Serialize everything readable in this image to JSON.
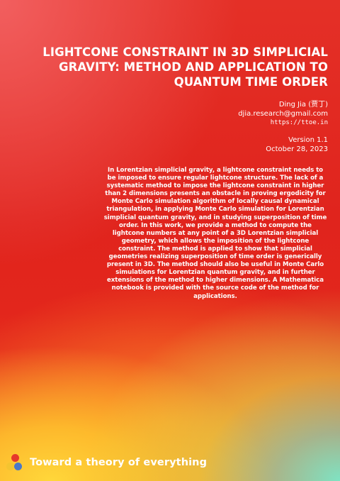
{
  "paper": {
    "title": "LIGHTCONE CONSTRAINT IN 3D SIMPLICIAL GRAVITY: METHOD AND APPLICATION TO QUANTUM TIME ORDER",
    "author": "Ding Jia (贾丁)",
    "email": "djia.research@gmail.com",
    "website": "https://ttoe.in",
    "version": "Version 1.1",
    "date": "October 28, 2023",
    "abstract": "In Lorentzian simplicial gravity, a lightcone constraint needs to be imposed to ensure regular lightcone structure. The lack of a systematic method to impose the lightcone constraint in higher than 2 dimensions presents an obstacle in proving ergodicity for Monte Carlo simulation algorithm of locally causal dynamical triangulation, in applying Monte Carlo simulation for Lorentzian simplicial quantum gravity, and in studying superposition of time order. In this work, we provide a method to compute the lightcone numbers at any point of a 3D Lorentzian simplicial geometry, which allows the imposition of the lightcone constraint. The method is applied to show that simplicial geometries realizing superposition of time order is generically present in 3D. The method should also be useful in Monte Carlo simulations for Lorentzian quantum gravity, and in further extensions of the method to higher dimensions. A Mathematica notebook is provided with the source code of the method for applications."
  },
  "footer": {
    "tagline": "Toward a theory of everything",
    "logo_colors": {
      "red": "#e6372b",
      "yellow": "#f4c430",
      "blue": "#4a78c8"
    }
  }
}
